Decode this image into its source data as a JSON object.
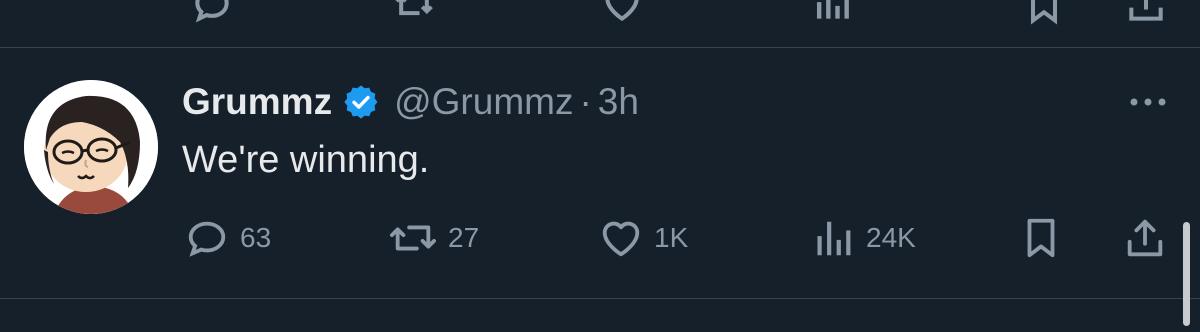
{
  "previous_tweet": {
    "actions": [
      "reply-icon",
      "retweet-icon",
      "like-icon",
      "views-icon",
      "bookmark-icon",
      "share-icon"
    ]
  },
  "tweet": {
    "author_name": "Grummz",
    "verified_icon": "verified-badge-icon",
    "handle": "@Grummz",
    "separator": "·",
    "time": "3h",
    "text": "We're winning.",
    "more_icon": "more-icon",
    "actions": {
      "reply": {
        "icon": "reply-icon",
        "count": "63"
      },
      "retweet": {
        "icon": "retweet-icon",
        "count": "27"
      },
      "like": {
        "icon": "like-icon",
        "count": "1K"
      },
      "views": {
        "icon": "views-icon",
        "count": "24K"
      },
      "bookmark": {
        "icon": "bookmark-icon"
      },
      "share": {
        "icon": "share-icon"
      }
    }
  },
  "colors": {
    "background": "#15202b",
    "primary_text": "#e7e9ea",
    "secondary_text": "#8b98a5",
    "divider": "#38444d",
    "verified": "#1d9bf0"
  }
}
